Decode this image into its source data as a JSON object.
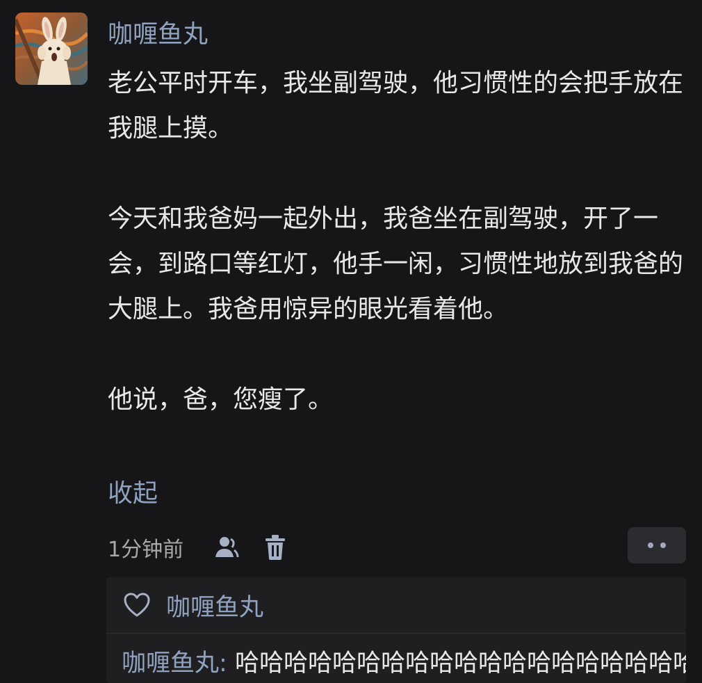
{
  "comment": {
    "username": "咖喱鱼丸",
    "paragraphs": [
      "老公平时开车，我坐副驾驶，他习惯性的会把手放在我腿上摸。",
      "今天和我爸妈一起外出，我爸坐在副驾驶，开了一会，到路口等红灯，他手一闲，习惯性地放到我爸的大腿上。我爸用惊异的眼光看着他。",
      "他说，爸，您瘦了。"
    ],
    "collapse_label": "收起",
    "timestamp": "1分钟前",
    "icons": {
      "user": "user-icon",
      "delete": "trash-icon",
      "more": "more-dots-icon",
      "like": "heart-icon"
    }
  },
  "likes": {
    "names": "咖喱鱼丸"
  },
  "reply": {
    "author": "咖喱鱼丸",
    "separator": ": ",
    "text": "哈哈哈哈哈哈哈哈哈哈哈哈哈哈哈哈哈哈哈哈哈哈"
  },
  "colors": {
    "background": "#161618",
    "link": "#8fa2bf",
    "text": "#e8e8ea",
    "muted": "#a8a8ad"
  }
}
